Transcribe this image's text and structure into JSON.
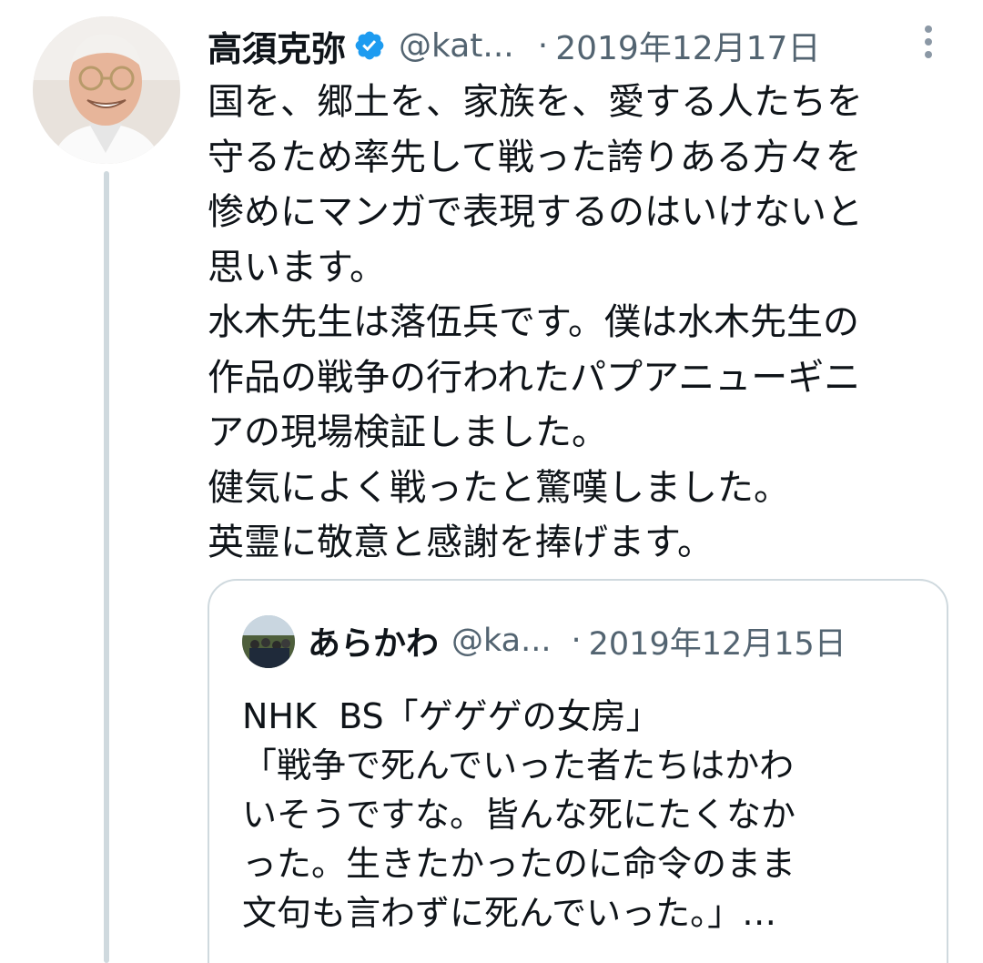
{
  "tweet": {
    "author_name": "高須克弥",
    "handle": "@kat...",
    "separator": "·",
    "date": "2019年12月17日",
    "text": "国を、郷土を、家族を、愛する人たちを\n守るため率先して戦った誇りある方々を\n惨めにマンガで表現するのはいけないと\n思います。\n水木先生は落伍兵です。僕は水木先生の\n作品の戦争の行われたパプアニューギニ\nアの現場検証しました。\n健気によく戦ったと驚嘆しました。\n英霊に敬意と感謝を捧げます。",
    "verified_icon": "verified-badge-icon",
    "more_icon": "more-vertical-icon"
  },
  "quoted_tweet": {
    "author_name": "あらかわ",
    "handle": "@ka...",
    "separator": "·",
    "date": "2019年12月15日",
    "text": "NHK  BS「ゲゲゲの女房」\n「戦争で死んでいった者たちはかわ\nいそうですな。皆んな死にたくなか\nった。生きたかったのに命令のまま\n文句も言わずに死んでいった。」…"
  },
  "colors": {
    "text_primary": "#0f1419",
    "text_secondary": "#536471",
    "verified_blue": "#1d9bf0",
    "border": "#cfd9de"
  }
}
